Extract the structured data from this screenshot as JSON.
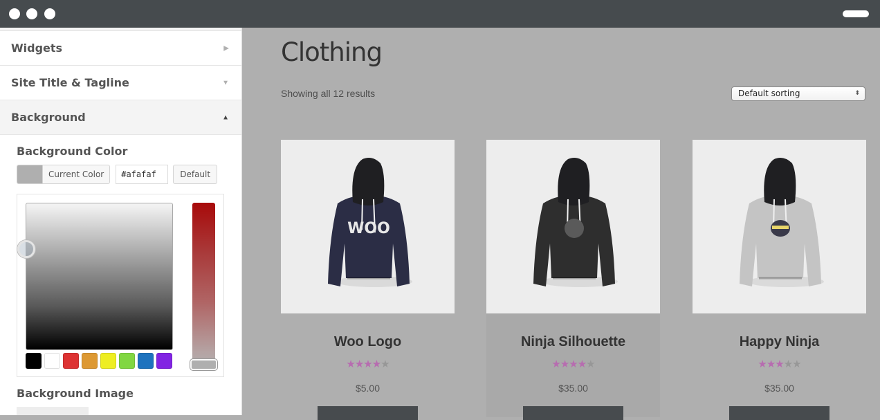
{
  "window": {
    "controls": [
      "close",
      "minimize",
      "maximize"
    ],
    "menu_icon": "menu-pill-icon"
  },
  "sidebar": {
    "sections": [
      {
        "label": "Widgets",
        "state": "collapsed",
        "arrow": "▶"
      },
      {
        "label": "Site Title & Tagline",
        "state": "collapsed",
        "arrow": "▼"
      },
      {
        "label": "Background",
        "state": "expanded",
        "arrow": "▲"
      }
    ],
    "background_panel": {
      "color_heading": "Background Color",
      "current_color_label": "Current Color",
      "hex_value": "#afafaf",
      "default_label": "Default",
      "palette": [
        "#000000",
        "#ffffff",
        "#dd3333",
        "#dd9933",
        "#eeee22",
        "#81d742",
        "#1e73be",
        "#8224e3"
      ],
      "image_heading": "Background Image"
    }
  },
  "main": {
    "title": "Clothing",
    "results_text": "Showing all 12 results",
    "sort": {
      "selected": "Default sorting",
      "arrows": "⬍"
    },
    "products": [
      {
        "name": "Woo Logo",
        "rating": 4,
        "max_rating": 5,
        "price": "$5.00",
        "hoodie_color": "#2b2d45",
        "print": "WOO"
      },
      {
        "name": "Ninja Silhouette",
        "rating": 4,
        "max_rating": 5,
        "price": "$35.00",
        "hoodie_color": "#2e2e2e",
        "print": ""
      },
      {
        "name": "Happy Ninja",
        "rating": 3,
        "max_rating": 5,
        "price": "$35.00",
        "hoodie_color": "#c4c4c4",
        "print": ""
      }
    ],
    "colors": {
      "star_on": "#b76cb0",
      "star_off": "#979797",
      "page_bg": "#afafaf"
    }
  }
}
